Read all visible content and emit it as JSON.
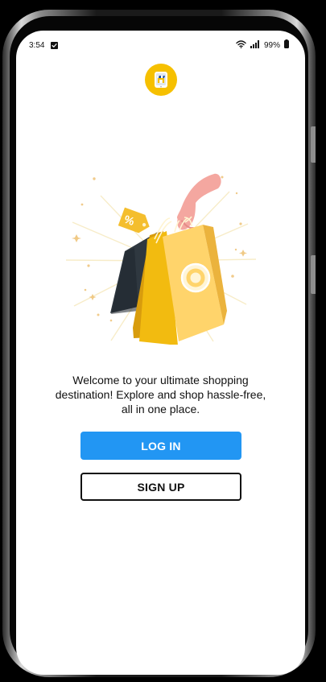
{
  "status_bar": {
    "time": "3:54",
    "battery": "99%"
  },
  "app": {
    "logo_icon": "store-phone-icon",
    "hero_icon": "shopping-bags-illustration",
    "tag_label": "%",
    "welcome_text": "Welcome to your ultimate shopping destination! Explore and shop hassle-free, all in one place."
  },
  "buttons": {
    "login_label": "LOG IN",
    "signup_label": "SIGN UP"
  },
  "colors": {
    "logo_bg": "#F6C000",
    "login_bg": "#2296F3",
    "signup_border": "#111111"
  }
}
